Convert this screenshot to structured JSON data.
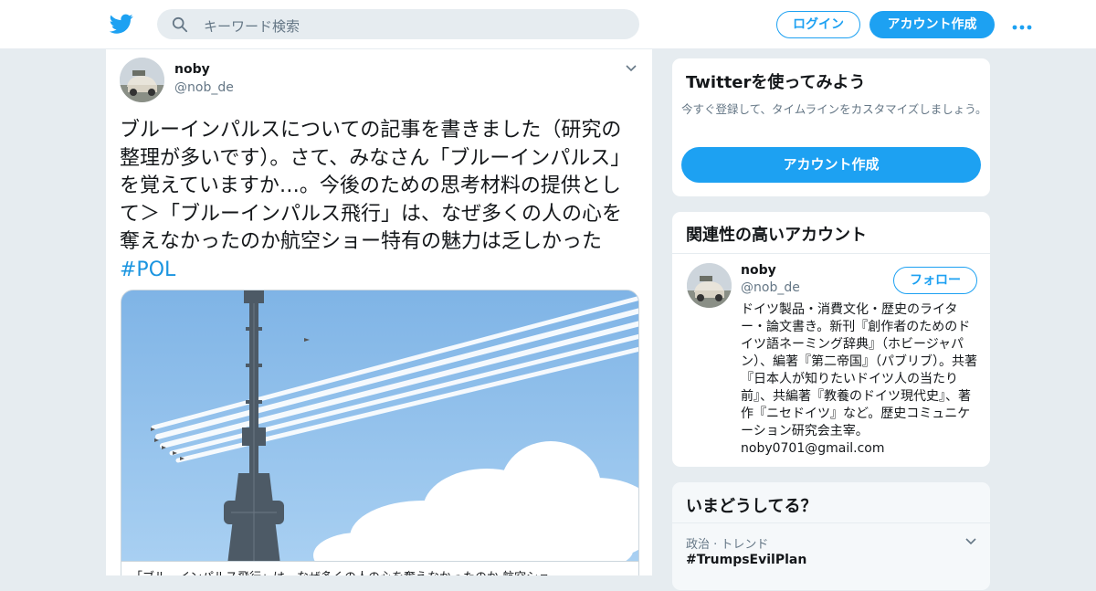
{
  "header": {
    "logo_icon": "twitter-bird-icon",
    "search_placeholder": "キーワード検索",
    "login_label": "ログイン",
    "signup_label": "アカウント作成",
    "more_icon": "more-dots-icon"
  },
  "tweet": {
    "name": "noby",
    "handle": "@nob_de",
    "text": "ブルーインパルスについての記事を書きました（研究の整理が多いです）。さて、みなさん「ブルーインパルス」を覚えていますか…。今後のための思考材料の提供として＞「ブルーインパルス飛行」は、なぜ多くの人の心を奪えなかったのか航空ショー特有の魅力は乏しかった",
    "hashtag": "#POL",
    "card_caption": "「ブルーインパルス飛行」は、なぜ多くの人の心を奪えなかったのか 航空ショー"
  },
  "signup_module": {
    "title": "Twitterを使ってみよう",
    "description": "今すぐ登録して、タイムラインをカスタマイズしましょう。",
    "cta_label": "アカウント作成"
  },
  "related_module": {
    "title": "関連性の高いアカウント",
    "name": "noby",
    "handle": "@nob_de",
    "follow_label": "フォロー",
    "bio": "ドイツ製品・消費文化・歴史のライター・論文書き。新刊『創作者のためのドイツ語ネーミング辞典』（ホビージャパン）、編著『第二帝国』（パブリブ）。共著『日本人が知りたいドイツ人の当たり前』、共編著『教養のドイツ現代史』、著作『ニセドイツ』など。歴史コミュニケーション研究会主宰。 noby0701@gmail.com"
  },
  "trends_module": {
    "title": "いまどうしてる？",
    "meta": "政治 · トレンド",
    "trend": "#TrumpsEvilPlan"
  },
  "colors": {
    "accent": "#1da1f2",
    "background": "#e6ecf0",
    "secondary_text": "#657786",
    "hashtag": "#1b95e0"
  }
}
